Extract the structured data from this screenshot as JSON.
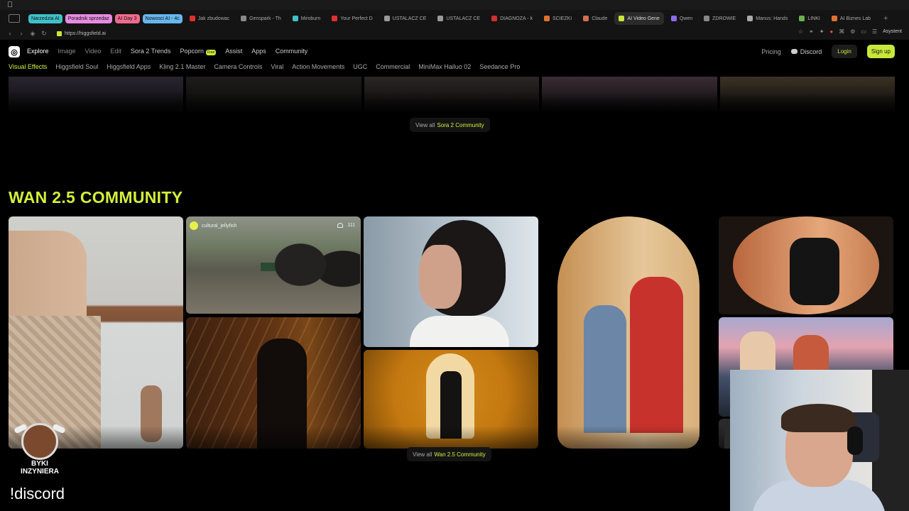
{
  "browser": {
    "tab_groups": [
      {
        "label": "Narzedzia AI",
        "color": "#3fc1c9"
      },
      {
        "label": "Poradnik sprzedaz",
        "color": "#e58be0"
      },
      {
        "label": "AI Day 3",
        "color": "#f06b8f"
      },
      {
        "label": "Nowosci AI - 4c",
        "color": "#66b6ef"
      }
    ],
    "tabs": [
      {
        "label": "Jak zbudowac",
        "fav_color": "#e03030"
      },
      {
        "label": "Genspark - Th",
        "fav_color": "#888888"
      },
      {
        "label": "Miroburn",
        "fav_color": "#3fc1c9"
      },
      {
        "label": "Your Perfect D",
        "fav_color": "#e03030"
      },
      {
        "label": "USTALACZ CE",
        "fav_color": "#999999"
      },
      {
        "label": "USTALACZ CE",
        "fav_color": "#999999"
      },
      {
        "label": "DIAGNOZA - k",
        "fav_color": "#d03030"
      },
      {
        "label": "SCIEZKI",
        "fav_color": "#e07030"
      },
      {
        "label": "Claude",
        "fav_color": "#d07050"
      },
      {
        "label": "AI Video Gene",
        "fav_color": "#c7e83a",
        "active": true
      },
      {
        "label": "Qwen",
        "fav_color": "#8a6cf0"
      },
      {
        "label": "ZDROWIE",
        "fav_color": "#888888"
      },
      {
        "label": "Manus: Hands",
        "fav_color": "#aaaaaa"
      },
      {
        "label": "LINKI",
        "fav_color": "#6ab04c"
      },
      {
        "label": "AI Biznes Lab",
        "fav_color": "#e07030"
      }
    ],
    "url": "https://higgsfield.ai",
    "assistant_label": "Asystent"
  },
  "header": {
    "logo_glyph": "◎",
    "nav": [
      {
        "label": "Explore",
        "state": "active"
      },
      {
        "label": "Image",
        "state": "dim"
      },
      {
        "label": "Video",
        "state": "dim"
      },
      {
        "label": "Edit",
        "state": "dim"
      },
      {
        "label": "Sora 2 Trends",
        "state": "light"
      },
      {
        "label": "Popcorn",
        "state": "light"
      },
      {
        "label": "Assist",
        "state": "light"
      },
      {
        "label": "Apps",
        "state": "light"
      },
      {
        "label": "Community",
        "state": "light"
      }
    ],
    "popcorn_badge": "Free",
    "pricing": "Pricing",
    "discord": "Discord",
    "login": "Login",
    "signup": "Sign up"
  },
  "subnav": [
    "Visual Effects",
    "Higgsfield Soul",
    "Higgsfield Apps",
    "Kling 2.1 Master",
    "Camera Controls",
    "Viral",
    "Action Movements",
    "UGC",
    "Commercial",
    "MiniMax Hailuo 02",
    "Seedance Pro"
  ],
  "sora_section": {
    "view_all_prefix": "View all",
    "view_all_name": "Sora 2 Community",
    "tile_colors": [
      "#2a2530",
      "#1e1c1b",
      "#2b2624",
      "#3a2c34",
      "#3a3224"
    ]
  },
  "wan_section": {
    "title": "WAN 2.5 COMMUNITY",
    "featured_user": "cultural_jellyfish",
    "featured_likes": "111",
    "view_all_prefix": "View all",
    "view_all_name": "Wan 2.5 Community"
  },
  "overlay": {
    "badge_text_line1": "BYKI",
    "badge_text_line2": "INZYNIERA",
    "chat_command": "!discord"
  }
}
